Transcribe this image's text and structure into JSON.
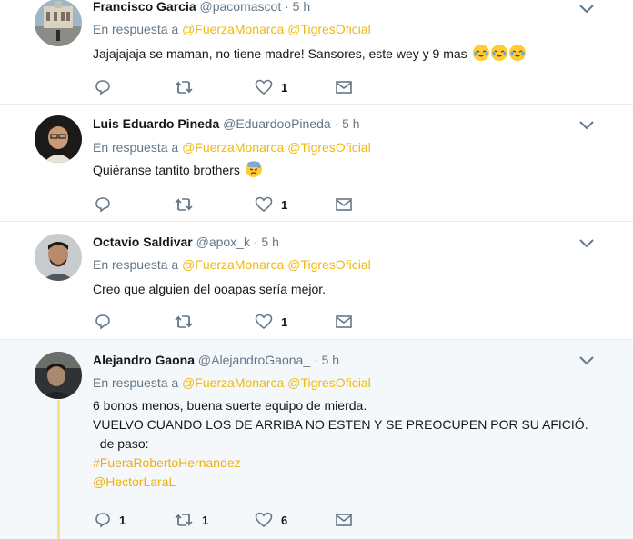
{
  "tweets": [
    {
      "fullname": "Francisco Garcia",
      "handle": "@pacomascot",
      "time": "5 h",
      "reply_prefix": "En respuesta a",
      "mentions": [
        "@FuerzaMonarca",
        "@TigresOficial"
      ],
      "lines": [
        "Jajajajaja se maman, no tiene madre! Sansores, este wey y 9 mas"
      ],
      "emojis": [
        "joy-emoji",
        "joy-emoji",
        "joy-emoji"
      ],
      "replies": "",
      "retweets": "",
      "likes": "1"
    },
    {
      "fullname": "Luis Eduardo Pineda",
      "handle": "@EduardooPineda",
      "time": "5 h",
      "reply_prefix": "En respuesta a",
      "mentions": [
        "@FuerzaMonarca",
        "@TigresOficial"
      ],
      "lines": [
        "Quiéranse tantito brothers"
      ],
      "emojis": [
        "downcast-sweat-emoji"
      ],
      "replies": "",
      "retweets": "",
      "likes": "1"
    },
    {
      "fullname": "Octavio Saldivar",
      "handle": "@apox_k",
      "time": "5 h",
      "reply_prefix": "En respuesta a",
      "mentions": [
        "@FuerzaMonarca",
        "@TigresOficial"
      ],
      "lines": [
        "Creo que alguien del ooapas sería mejor."
      ],
      "replies": "",
      "retweets": "",
      "likes": "1"
    },
    {
      "fullname": "Alejandro Gaona",
      "handle": "@AlejandroGaona_",
      "time": "5 h",
      "reply_prefix": "En respuesta a",
      "mentions": [
        "@FuerzaMonarca",
        "@TigresOficial"
      ],
      "lines": [
        "6 bonos menos, buena suerte equipo de mierda.",
        "VUELVO CUANDO LOS DE ARRIBA NO ESTEN Y SE PREOCUPEN POR SU AFICIÓ.",
        "  de paso:"
      ],
      "links": [
        "#FueraRobertoHernandez",
        "@HectorLaraL"
      ],
      "replies": "1",
      "retweets": "1",
      "likes": "6"
    }
  ],
  "colors": {
    "link": "#eeb00f",
    "muted": "#657786",
    "text": "#14171a",
    "highlight_bg": "#f5f8fa",
    "thread_line": "#f4e38a"
  }
}
